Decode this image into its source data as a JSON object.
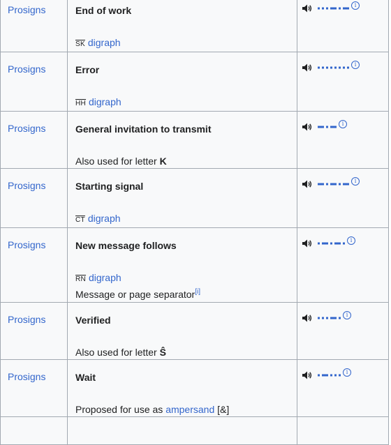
{
  "colors": {
    "link": "#3366cc",
    "border": "#a2a9b1",
    "cell_bg": "#f8f9fa",
    "text": "#202122"
  },
  "icons": {
    "audio": "speaker-icon",
    "info": "info-icon"
  },
  "rows": [
    {
      "category": "Prosigns",
      "name": "End of work",
      "prosign": "SK",
      "digraph_label": "digraph",
      "code": "...-.-"
    },
    {
      "category": "Prosigns",
      "name": "Error",
      "prosign": "HH",
      "digraph_label": "digraph",
      "code": "........"
    },
    {
      "category": "Prosigns",
      "name": "General invitation to transmit",
      "letter_prefix": "Also used for letter ",
      "letter": "K",
      "code": "-.-"
    },
    {
      "category": "Prosigns",
      "name": "Starting signal",
      "prosign": "CT",
      "digraph_label": "digraph",
      "code": "-.-.-"
    },
    {
      "category": "Prosigns",
      "name": "New message follows",
      "prosign": "RN",
      "digraph_label": "digraph",
      "note": "Message or page separator",
      "note_ref": "[i]",
      "code": ".-.-."
    },
    {
      "category": "Prosigns",
      "name": "Verified",
      "letter_prefix": "Also used for letter ",
      "letter": "Ŝ",
      "code": "...-."
    },
    {
      "category": "Prosigns",
      "name": "Wait",
      "proposal_prefix": "Proposed for use as ",
      "proposal_link": "ampersand",
      "proposal_suffix": " [&]",
      "code": ".-..."
    }
  ],
  "info_symbol": "i"
}
